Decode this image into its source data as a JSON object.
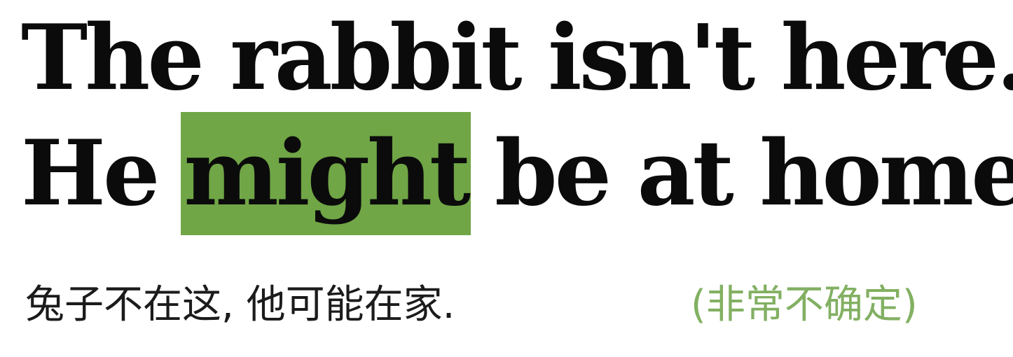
{
  "sentence1": "The rabbit isn't here.",
  "sentence2": {
    "before": "He",
    "highlight": "might",
    "after": "be at home."
  },
  "translation": "兔子不在这, 他可能在家.",
  "note": "(非常不确定)",
  "colors": {
    "highlight": "#70a646",
    "note": "#82b062",
    "text": "#0b0b0b"
  }
}
